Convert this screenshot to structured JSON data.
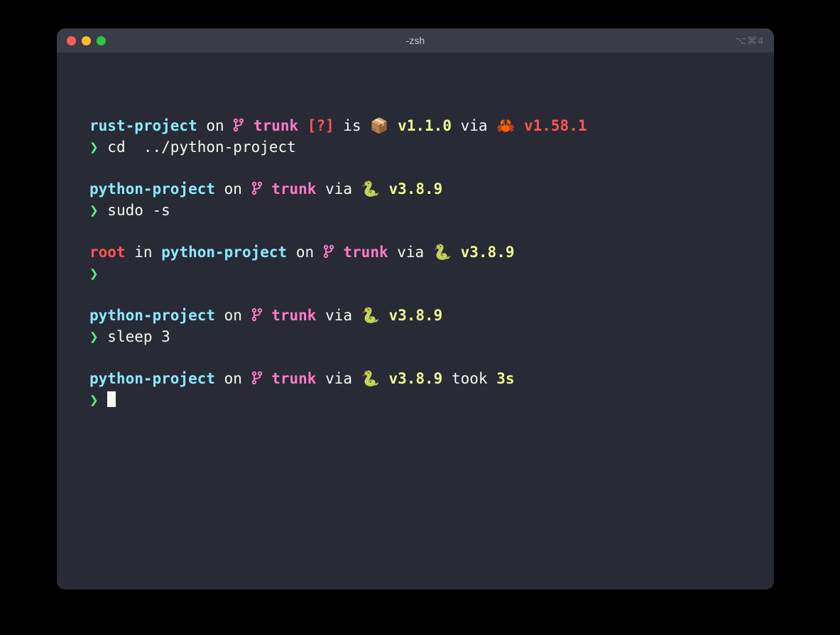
{
  "window": {
    "title": "-zsh",
    "tab_indicator": "⌥⌘4"
  },
  "colors": {
    "bg": "#282a36",
    "fg": "#f8f8f2",
    "cyan": "#8be9fd",
    "pink": "#ff79c6",
    "red": "#ff5555",
    "yellow": "#f1fa8c",
    "green": "#50fa7b",
    "orange": "#ffb86c"
  },
  "icons": {
    "branch": "branch-icon",
    "package": "📦",
    "crab": "🦀",
    "python": "🐍"
  },
  "blocks": [
    {
      "prompt": [
        {
          "text": "rust-project",
          "cls": "c-dir"
        },
        {
          "text": " on ",
          "cls": "c-white"
        },
        {
          "icon": "branch",
          "cls": "c-branch"
        },
        {
          "text": " trunk",
          "cls": "c-branch"
        },
        {
          "text": " [?]",
          "cls": "c-red"
        },
        {
          "text": " is ",
          "cls": "c-white"
        },
        {
          "text": "📦 ",
          "cls": "c-white"
        },
        {
          "text": "v1.1.0",
          "cls": "c-yellow"
        },
        {
          "text": " via ",
          "cls": "c-white"
        },
        {
          "text": "🦀 ",
          "cls": "c-orange"
        },
        {
          "text": "v1.58.1",
          "cls": "c-redb"
        }
      ],
      "symbol": "❯",
      "command": "cd  ../python-project"
    },
    {
      "prompt": [
        {
          "text": "python-project",
          "cls": "c-dir"
        },
        {
          "text": " on ",
          "cls": "c-white"
        },
        {
          "icon": "branch",
          "cls": "c-branch"
        },
        {
          "text": " trunk",
          "cls": "c-branch"
        },
        {
          "text": " via ",
          "cls": "c-white"
        },
        {
          "text": "🐍 ",
          "cls": "c-white"
        },
        {
          "text": "v3.8.9",
          "cls": "c-yellow"
        }
      ],
      "symbol": "❯",
      "command": "sudo -s"
    },
    {
      "prompt": [
        {
          "text": "root",
          "cls": "c-user"
        },
        {
          "text": " in ",
          "cls": "c-white"
        },
        {
          "text": "python-project",
          "cls": "c-dir"
        },
        {
          "text": " on ",
          "cls": "c-white"
        },
        {
          "icon": "branch",
          "cls": "c-branch"
        },
        {
          "text": " trunk",
          "cls": "c-branch"
        },
        {
          "text": " via ",
          "cls": "c-white"
        },
        {
          "text": "🐍 ",
          "cls": "c-white"
        },
        {
          "text": "v3.8.9",
          "cls": "c-yellow"
        }
      ],
      "symbol": "❯",
      "command": ""
    },
    {
      "prompt": [
        {
          "text": "python-project",
          "cls": "c-dir"
        },
        {
          "text": " on ",
          "cls": "c-white"
        },
        {
          "icon": "branch",
          "cls": "c-branch"
        },
        {
          "text": " trunk",
          "cls": "c-branch"
        },
        {
          "text": " via ",
          "cls": "c-white"
        },
        {
          "text": "🐍 ",
          "cls": "c-white"
        },
        {
          "text": "v3.8.9",
          "cls": "c-yellow"
        }
      ],
      "symbol": "❯",
      "command": "sleep 3"
    },
    {
      "prompt": [
        {
          "text": "python-project",
          "cls": "c-dir"
        },
        {
          "text": " on ",
          "cls": "c-white"
        },
        {
          "icon": "branch",
          "cls": "c-branch"
        },
        {
          "text": " trunk",
          "cls": "c-branch"
        },
        {
          "text": " via ",
          "cls": "c-white"
        },
        {
          "text": "🐍 ",
          "cls": "c-white"
        },
        {
          "text": "v3.8.9",
          "cls": "c-yellow"
        },
        {
          "text": " took ",
          "cls": "c-white"
        },
        {
          "text": "3s",
          "cls": "c-took"
        }
      ],
      "symbol": "❯",
      "command": "",
      "cursor": true
    }
  ]
}
